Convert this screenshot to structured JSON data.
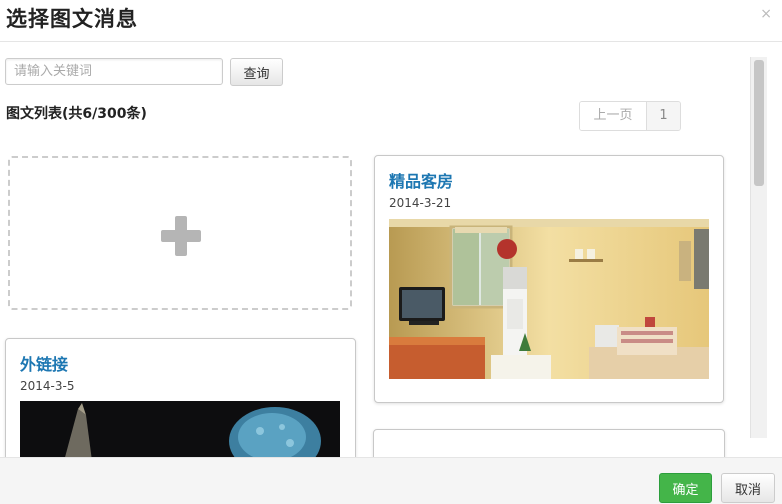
{
  "dialog": {
    "title": "选择图文消息",
    "close_label": "×"
  },
  "search": {
    "placeholder": "请输入关键词",
    "button_label": "查询"
  },
  "list": {
    "title": "图文列表(共6/300条)"
  },
  "pager": {
    "prev_label": "上一页",
    "current_page": "1"
  },
  "cards": [
    {
      "title": "精品客房",
      "date": "2014-3-21",
      "image": "hotel-room-photo"
    },
    {
      "title": "外链接",
      "date": "2014-3-5",
      "image": "night-scene-photo"
    }
  ],
  "footer": {
    "confirm_label": "确定",
    "cancel_label": "取消"
  },
  "colors": {
    "confirm_green": "#44b549",
    "card_title_blue": "#1d77b2"
  }
}
